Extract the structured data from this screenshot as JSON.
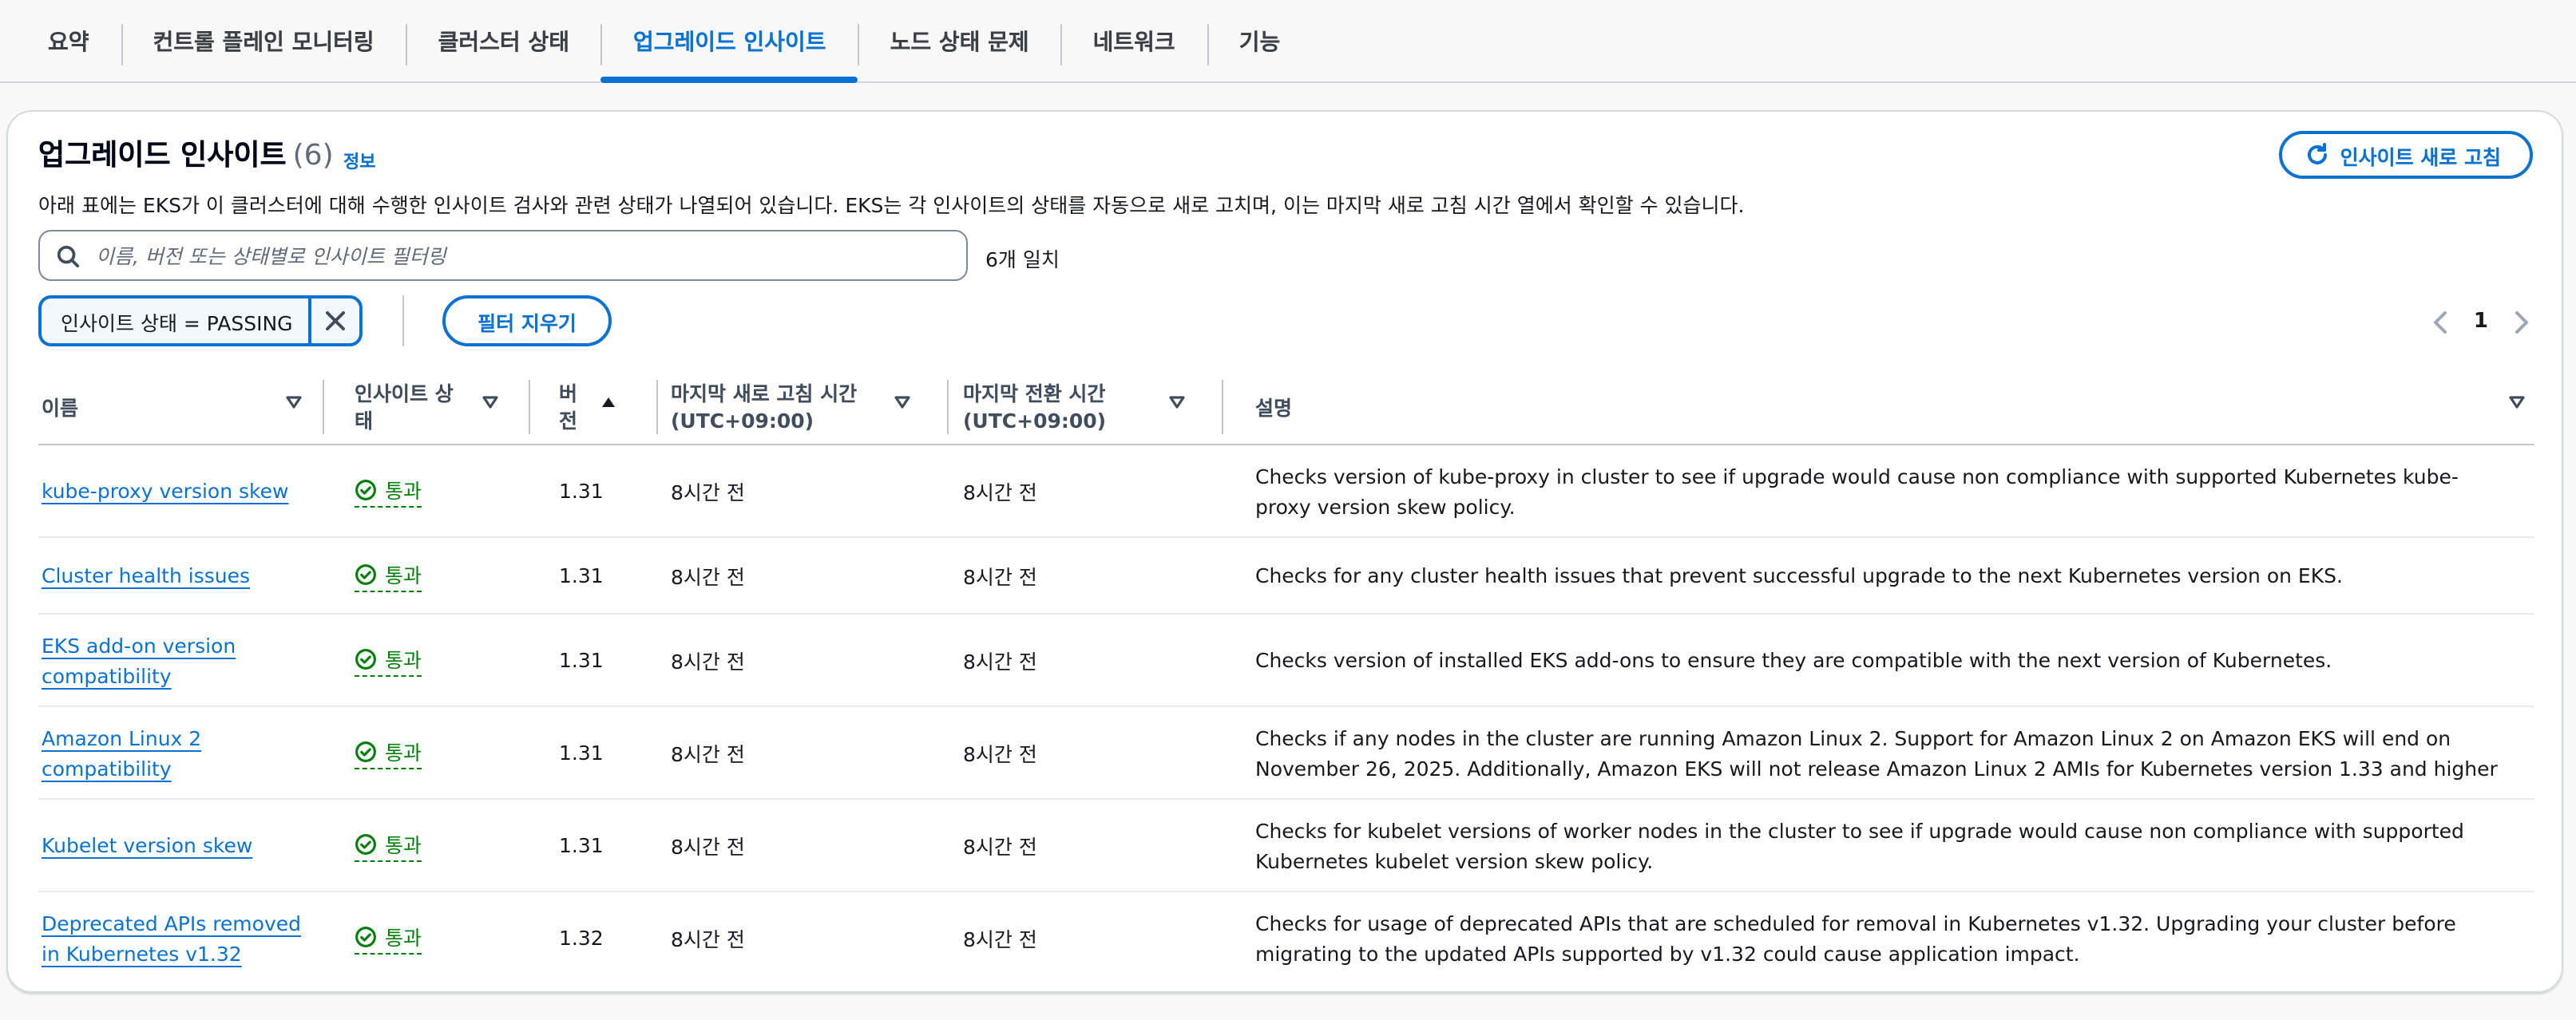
{
  "tabs": [
    {
      "label": "요약"
    },
    {
      "label": "컨트롤 플레인 모니터링"
    },
    {
      "label": "클러스터 상태"
    },
    {
      "label": "업그레이드 인사이트"
    },
    {
      "label": "노드 상태 문제"
    },
    {
      "label": "네트워크"
    },
    {
      "label": "기능"
    }
  ],
  "active_tab": "업그레이드 인사이트",
  "panel": {
    "title": "업그레이드 인사이트",
    "count": "(6)",
    "info_link": "정보",
    "description": "아래 표에는 EKS가 이 클러스터에 대해 수행한 인사이트 검사와 관련 상태가 나열되어 있습니다. EKS는 각 인사이트의 상태를 자동으로 새로 고치며, 이는 마지막 새로 고침 시간 열에서 확인할 수 있습니다.",
    "refresh_button": "인사이트 새로 고침"
  },
  "search": {
    "placeholder": "이름, 버전 또는 상태별로 인사이트 필터링",
    "value": "",
    "match_count": "6개 일치"
  },
  "filter_token": {
    "label": "인사이트 상태 = PASSING"
  },
  "clear_filters_button": "필터 지우기",
  "pagination": {
    "current_page": "1"
  },
  "table": {
    "columns": {
      "name": "이름",
      "status": "인사이트 상태",
      "version": "버전",
      "last_refresh": "마지막 새로 고침 시간 (UTC+09:00)",
      "last_transition": "마지막 전환 시간 (UTC+09:00)",
      "description": "설명"
    },
    "rows": [
      {
        "name": "kube-proxy version skew",
        "status": "통과",
        "version": "1.31",
        "last_refresh": "8시간 전",
        "last_transition": "8시간 전",
        "description": "Checks version of kube-proxy in cluster to see if upgrade would cause non compliance with supported Kubernetes kube-proxy version skew policy."
      },
      {
        "name": "Cluster health issues",
        "status": "통과",
        "version": "1.31",
        "last_refresh": "8시간 전",
        "last_transition": "8시간 전",
        "description": "Checks for any cluster health issues that prevent successful upgrade to the next Kubernetes version on EKS."
      },
      {
        "name": "EKS add-on version compatibility",
        "status": "통과",
        "version": "1.31",
        "last_refresh": "8시간 전",
        "last_transition": "8시간 전",
        "description": "Checks version of installed EKS add-ons to ensure they are compatible with the next version of Kubernetes."
      },
      {
        "name": "Amazon Linux 2 compatibility",
        "status": "통과",
        "version": "1.31",
        "last_refresh": "8시간 전",
        "last_transition": "8시간 전",
        "description": "Checks if any nodes in the cluster are running Amazon Linux 2. Support for Amazon Linux 2 on Amazon EKS will end on November 26, 2025. Additionally, Amazon EKS will not release Amazon Linux 2 AMIs for Kubernetes version 1.33 and higher"
      },
      {
        "name": "Kubelet version skew",
        "status": "통과",
        "version": "1.31",
        "last_refresh": "8시간 전",
        "last_transition": "8시간 전",
        "description": "Checks for kubelet versions of worker nodes in the cluster to see if upgrade would cause non compliance with supported Kubernetes kubelet version skew policy."
      },
      {
        "name": "Deprecated APIs removed in Kubernetes v1.32",
        "status": "통과",
        "version": "1.32",
        "last_refresh": "8시간 전",
        "last_transition": "8시간 전",
        "description": "Checks for usage of deprecated APIs that are scheduled for removal in Kubernetes v1.32. Upgrading your cluster before migrating to the updated APIs supported by v1.32 could cause application impact."
      }
    ]
  },
  "colors": {
    "link": "#0972d3",
    "success": "#037f0c",
    "text": "#16191f",
    "border": "#c6c6cd"
  }
}
